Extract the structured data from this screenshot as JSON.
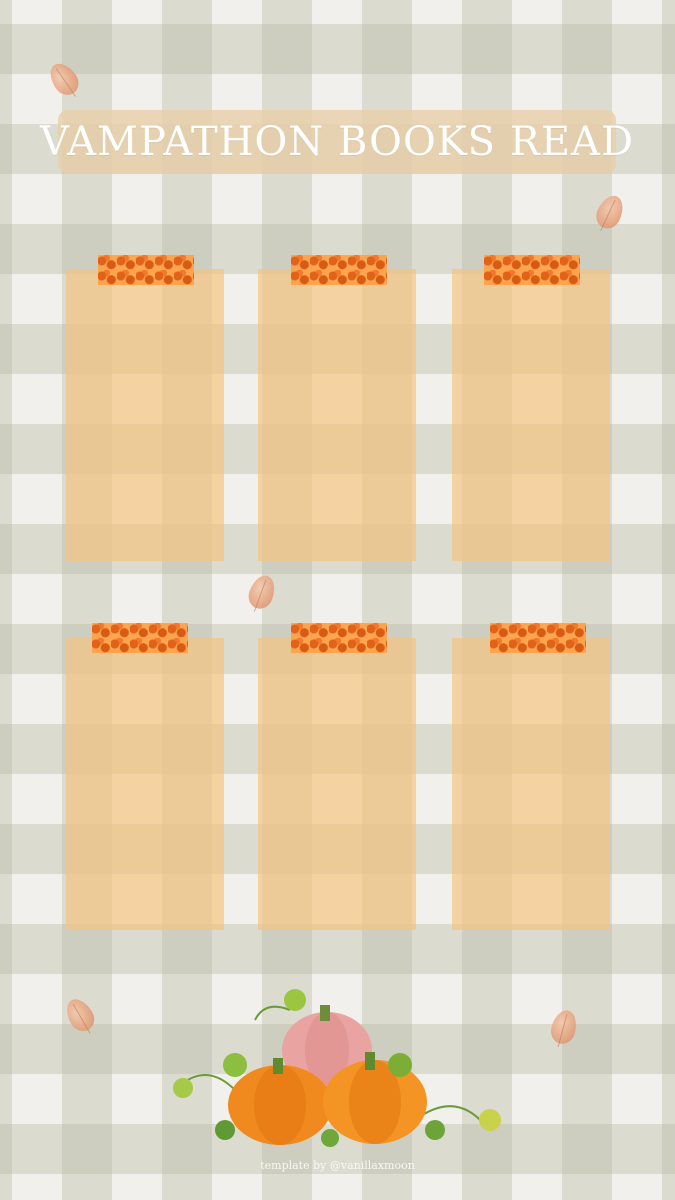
{
  "title": "VAMPATHON BOOKS READ",
  "credit": "template by @vanillaxmoon",
  "colors": {
    "card": "#f5c482",
    "tape": "#ff9f45",
    "banner": "#e8d0aa",
    "gingham": "#b9bca5",
    "background": "#f2f0ec"
  },
  "book_slots": [
    {
      "id": "slot-1"
    },
    {
      "id": "slot-2"
    },
    {
      "id": "slot-3"
    },
    {
      "id": "slot-4"
    },
    {
      "id": "slot-5"
    },
    {
      "id": "slot-6"
    }
  ],
  "decorations": {
    "leaves": [
      "autumn-leaf-icon",
      "autumn-leaf-icon",
      "autumn-leaf-icon",
      "autumn-leaf-icon",
      "autumn-leaf-icon"
    ],
    "illustration": "pumpkins-illustration"
  }
}
